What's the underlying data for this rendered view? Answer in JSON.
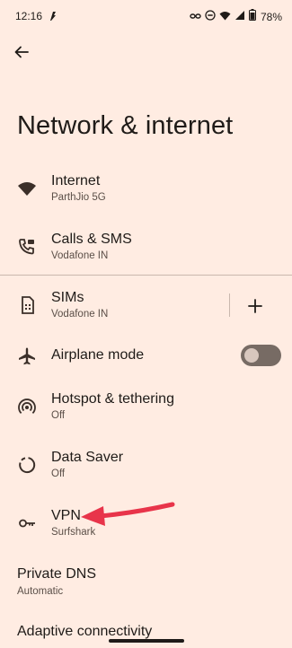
{
  "status": {
    "time": "12:16",
    "battery": "78%"
  },
  "page": {
    "title": "Network & internet"
  },
  "items": [
    {
      "label": "Internet",
      "sub": "ParthJio 5G",
      "icon": "wifi-icon"
    },
    {
      "label": "Calls & SMS",
      "sub": "Vodafone IN",
      "icon": "calls-sms-icon"
    },
    {
      "label": "SIMs",
      "sub": "Vodafone IN",
      "icon": "sim-icon"
    },
    {
      "label": "Airplane mode",
      "icon": "airplane-icon",
      "toggle": false
    },
    {
      "label": "Hotspot & tethering",
      "sub": "Off",
      "icon": "hotspot-icon"
    },
    {
      "label": "Data Saver",
      "sub": "Off",
      "icon": "data-saver-icon"
    },
    {
      "label": "VPN",
      "sub": "Surfshark",
      "icon": "key-icon"
    },
    {
      "label": "Private DNS",
      "sub": "Automatic"
    },
    {
      "label": "Adaptive connectivity"
    }
  ],
  "colors": {
    "background": "#ffece2",
    "annotation_arrow": "#e8344a",
    "toggle_track": "#776b64"
  }
}
